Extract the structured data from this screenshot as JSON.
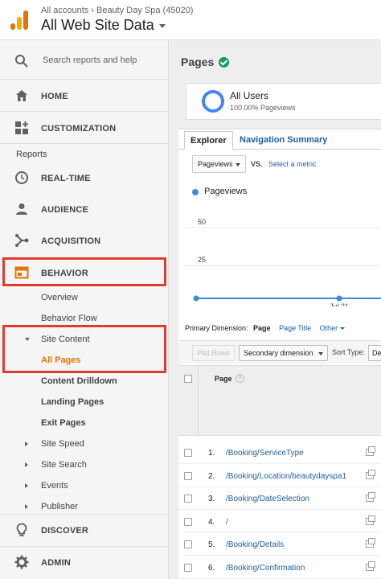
{
  "header": {
    "account_root": "All accounts",
    "property": "Beauty Day Spa (45020)",
    "view_title": "All Web Site Data"
  },
  "sidebar": {
    "search_placeholder": "Search reports and help",
    "reports_label": "Reports",
    "items": {
      "home": "HOME",
      "customization": "CUSTOMIZATION",
      "realtime": "REAL-TIME",
      "audience": "AUDIENCE",
      "acquisition": "ACQUISITION",
      "behavior": "BEHAVIOR",
      "discover": "DISCOVER",
      "admin": "ADMIN"
    },
    "behavior_sub": {
      "overview": "Overview",
      "behavior_flow": "Behavior Flow",
      "site_content": "Site Content",
      "all_pages": "All Pages",
      "content_drilldown": "Content Drilldown",
      "landing_pages": "Landing Pages",
      "exit_pages": "Exit Pages",
      "site_speed": "Site Speed",
      "site_search": "Site Search",
      "events": "Events",
      "publisher": "Publisher"
    },
    "highlight_color": "#e23b2e"
  },
  "main": {
    "page_title": "Pages",
    "segment": {
      "name": "All Users",
      "sub": "100.00% Pageviews"
    },
    "tabs": {
      "explorer": "Explorer",
      "nav_summary": "Navigation Summary"
    },
    "metric": {
      "selected": "Pageviews",
      "vs": "VS.",
      "select_metric": "Select a metric"
    },
    "legend": "Pageviews",
    "primary_dimension": {
      "label": "Primary Dimension:",
      "current": "Page",
      "page_title": "Page Title",
      "other": "Other"
    },
    "toolbar": {
      "plot_rows": "Plot Rows",
      "secondary_dimension": "Secondary dimension",
      "sort_type": "Sort Type:",
      "sort_value": "De"
    },
    "table": {
      "header_page": "Page",
      "help_glyph": "?",
      "rows": [
        {
          "num": "1.",
          "path": "/Booking/ServiceType"
        },
        {
          "num": "2.",
          "path": "/Booking/Location/beautydayspa1"
        },
        {
          "num": "3.",
          "path": "/Booking/DateSelection"
        },
        {
          "num": "4.",
          "path": "/"
        },
        {
          "num": "5.",
          "path": "/Booking/Details"
        },
        {
          "num": "6.",
          "path": "/Booking/Confirmation"
        }
      ]
    },
    "accent_color": "#1e5ea8",
    "series_color": "#3c8cdc"
  },
  "chart_data": {
    "type": "line",
    "x": [
      "...",
      "Jul 21",
      ""
    ],
    "series": [
      {
        "name": "Pageviews",
        "values": [
          0,
          0,
          0
        ]
      }
    ],
    "y_ticks": [
      "50",
      "25"
    ],
    "x_ticks": [
      "...",
      "Jul 21"
    ],
    "ylim": [
      0,
      50
    ],
    "grid": true
  }
}
